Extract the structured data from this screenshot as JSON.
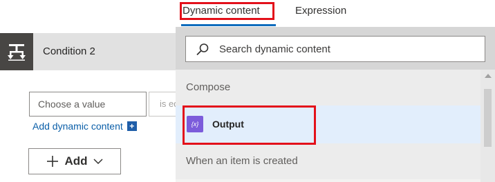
{
  "condition": {
    "title": "Condition 2",
    "value_placeholder": "Choose a value",
    "operator_text": "is equal to",
    "add_dynamic_label": "Add dynamic content",
    "add_dynamic_plus": "+",
    "add_button_label": "Add"
  },
  "panel": {
    "tabs": [
      {
        "label": "Dynamic content",
        "active": true
      },
      {
        "label": "Expression",
        "active": false
      }
    ],
    "search": {
      "placeholder": "Search dynamic content",
      "value": ""
    },
    "groups": [
      {
        "header": "Compose",
        "items": [
          {
            "label": "Output",
            "icon": "{x}",
            "icon_name": "compose-variable-icon"
          }
        ]
      },
      {
        "header": "When an item is created",
        "items": []
      }
    ]
  },
  "colors": {
    "accent_blue": "#0f6cbd",
    "highlight_red": "#e3101a",
    "compose_purple": "#7c5cdb",
    "selected_row": "#e2eefc",
    "header_gray": "#e1e1e1"
  }
}
